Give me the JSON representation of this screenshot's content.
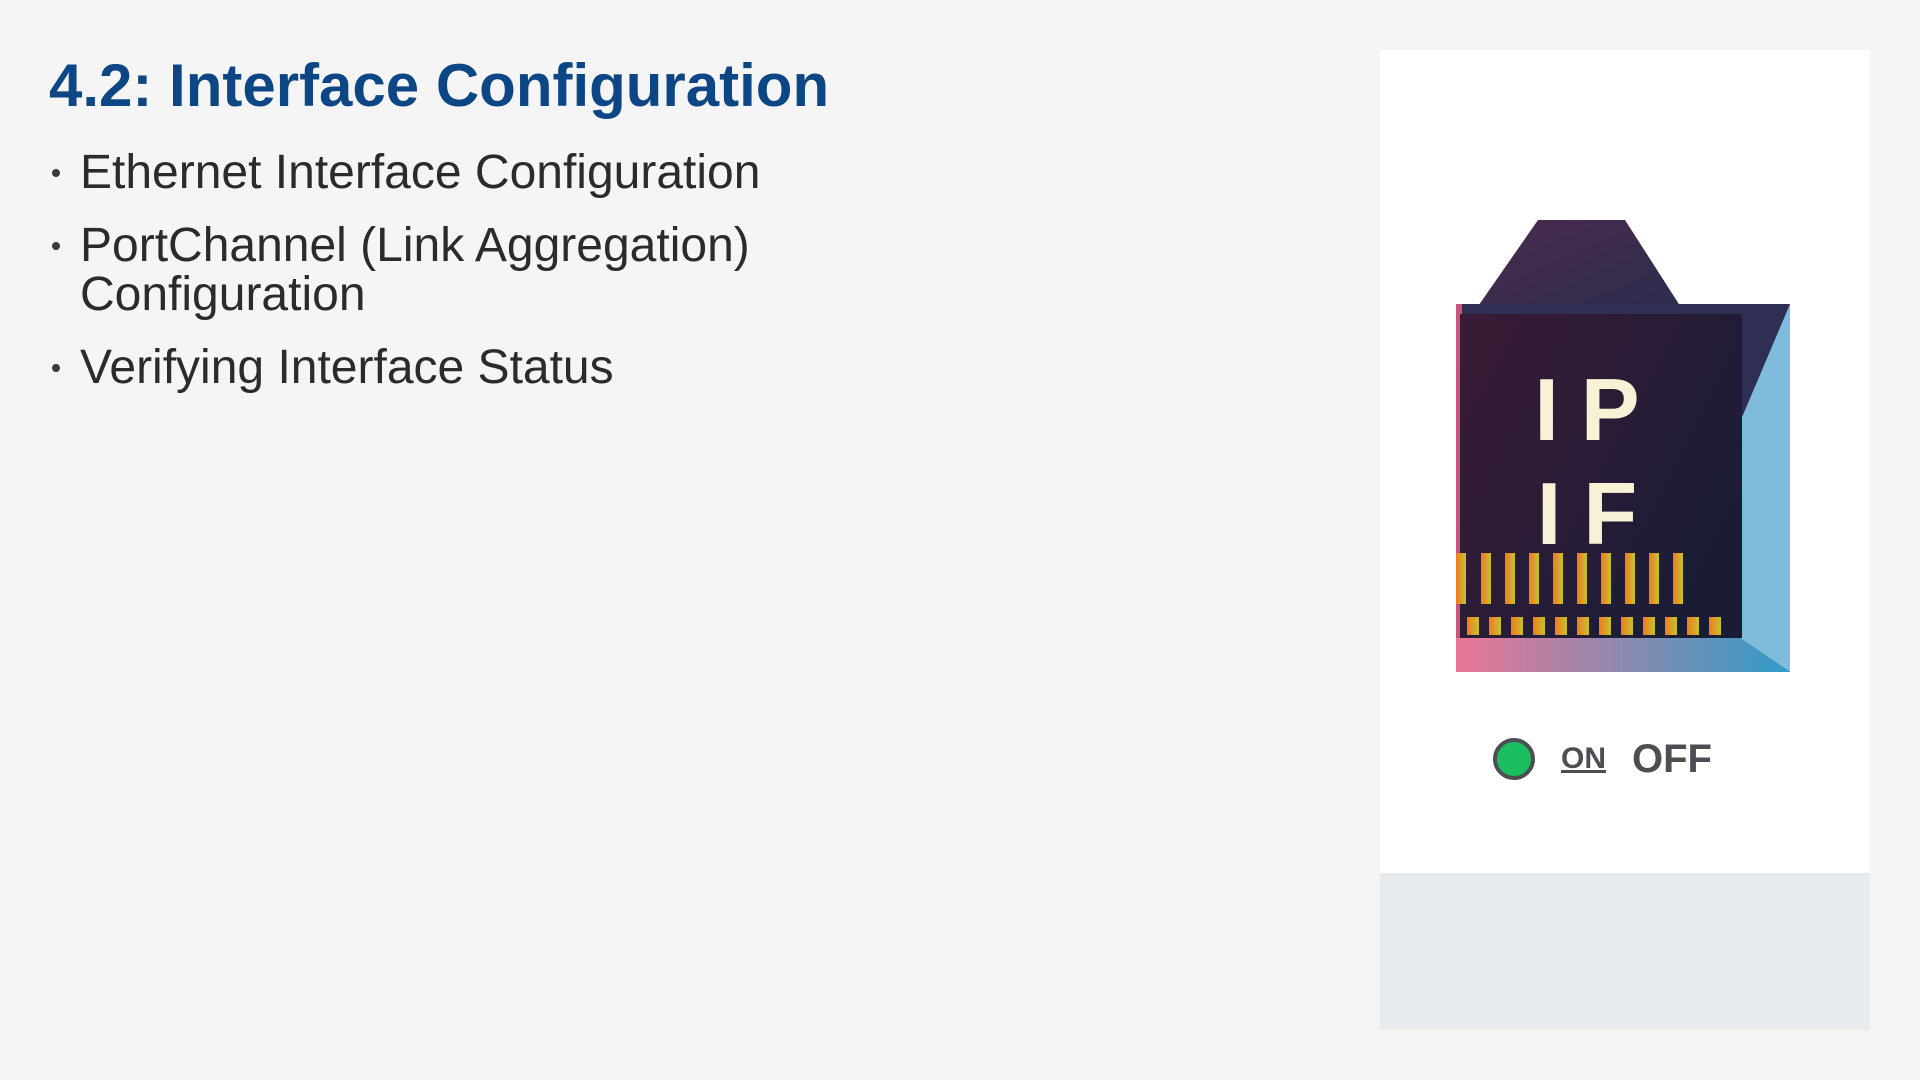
{
  "slide": {
    "title": "4.2: Interface Configuration",
    "bullets": [
      "Ethernet Interface Configuration",
      "PortChannel (Link Aggregation) Configuration",
      "Verifying Interface Status"
    ]
  },
  "illustration": {
    "icon_line1": "IP",
    "icon_line2": "IF",
    "toggle_on_label": "ON",
    "toggle_off_label": "OFF",
    "status_led_color": "#1bbf5f"
  }
}
